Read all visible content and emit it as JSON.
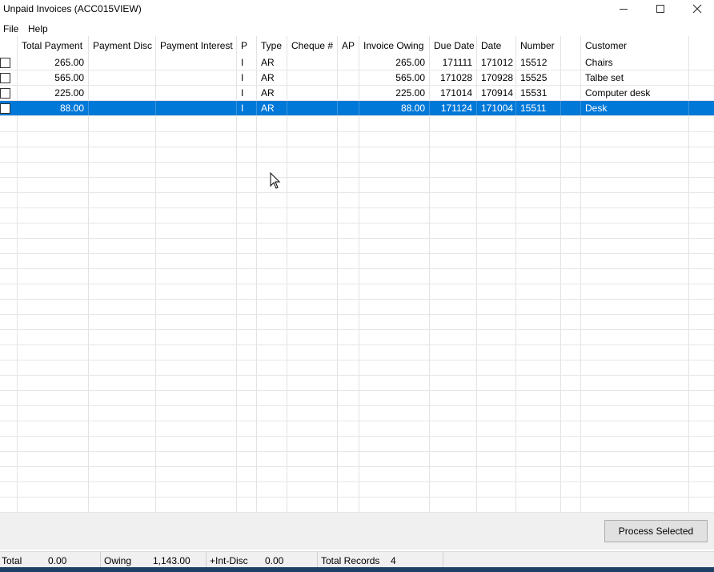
{
  "window": {
    "title": "Unpaid Invoices (ACC015VIEW)"
  },
  "menu": [
    "File",
    "Help"
  ],
  "table": {
    "columns": [
      "",
      "Total Payment",
      "Payment Disc",
      "Payment Interest",
      "P",
      "Type",
      "Cheque #",
      "AP",
      "Invoice Owing",
      "Due Date",
      "Date",
      "Number",
      "",
      "Customer"
    ],
    "rows": [
      {
        "checked": false,
        "total_payment": "265.00",
        "payment_disc": "",
        "payment_interest": "",
        "p": "I",
        "type": "AR",
        "cheque": "",
        "ap": "",
        "invoice_owing": "265.00",
        "due_date": "171111",
        "date": "171012",
        "number": "15512",
        "extra": "",
        "customer": "Chairs",
        "selected": false
      },
      {
        "checked": false,
        "total_payment": "565.00",
        "payment_disc": "",
        "payment_interest": "",
        "p": "I",
        "type": "AR",
        "cheque": "",
        "ap": "",
        "invoice_owing": "565.00",
        "due_date": "171028",
        "date": "170928",
        "number": "15525",
        "extra": "",
        "customer": "Talbe set",
        "selected": false
      },
      {
        "checked": false,
        "total_payment": "225.00",
        "payment_disc": "",
        "payment_interest": "",
        "p": "I",
        "type": "AR",
        "cheque": "",
        "ap": "",
        "invoice_owing": "225.00",
        "due_date": "171014",
        "date": "170914",
        "number": "15531",
        "extra": "",
        "customer": "Computer desk",
        "selected": false
      },
      {
        "checked": false,
        "total_payment": "88.00",
        "payment_disc": "",
        "payment_interest": "",
        "p": "I",
        "type": "AR",
        "cheque": "",
        "ap": "",
        "invoice_owing": "88.00",
        "due_date": "171124",
        "date": "171004",
        "number": "15511",
        "extra": "",
        "customer": "Desk",
        "selected": true
      }
    ]
  },
  "actions": {
    "process_selected_label": "Process Selected"
  },
  "status_bar": {
    "total_label": "Total",
    "total_value": "0.00",
    "owing_label": "Owing",
    "owing_value": "1,143.00",
    "int_disc_label": "+Int-Disc",
    "int_disc_value": "0.00",
    "records_label": "Total Records",
    "records_value": "4"
  },
  "colors": {
    "selection": "#0078d7",
    "footer_bg": "#f0f0f0",
    "taskbar": "#1e3f66"
  }
}
